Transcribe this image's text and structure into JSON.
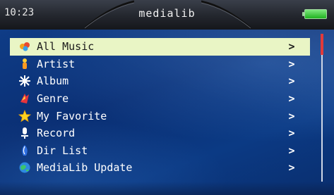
{
  "status_bar": {
    "time": "10:23",
    "title": "medialib"
  },
  "menu": {
    "items": [
      {
        "label": "All Music",
        "icon": "all-music-icon",
        "selected": true,
        "chevron": ">"
      },
      {
        "label": "Artist",
        "icon": "artist-icon",
        "selected": false,
        "chevron": ">"
      },
      {
        "label": "Album",
        "icon": "album-icon",
        "selected": false,
        "chevron": ">"
      },
      {
        "label": "Genre",
        "icon": "genre-icon",
        "selected": false,
        "chevron": ">"
      },
      {
        "label": "My Favorite",
        "icon": "favorite-star-icon",
        "selected": false,
        "chevron": ">"
      },
      {
        "label": "Record",
        "icon": "record-icon",
        "selected": false,
        "chevron": ">"
      },
      {
        "label": "Dir List",
        "icon": "dir-list-icon",
        "selected": false,
        "chevron": ">"
      },
      {
        "label": "MediaLib Update",
        "icon": "update-globe-icon",
        "selected": false,
        "chevron": ">"
      }
    ]
  },
  "colors": {
    "selected_row": "#e9f5c5",
    "scroll_thumb": "#e23a3a",
    "background": "#0b3a84"
  }
}
